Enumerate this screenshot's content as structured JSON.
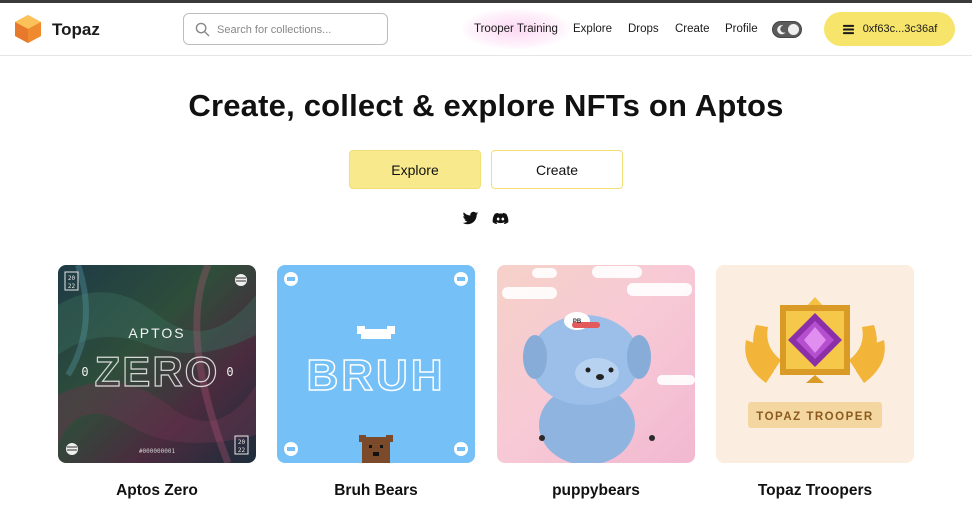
{
  "brand": {
    "name": "Topaz"
  },
  "search": {
    "placeholder": "Search for collections..."
  },
  "nav": {
    "links": [
      "Trooper Training",
      "Explore",
      "Drops",
      "Create",
      "Profile"
    ]
  },
  "wallet": {
    "address": "0xf63c...3c36af"
  },
  "hero": {
    "title": "Create, collect & explore NFTs on Aptos",
    "explore_label": "Explore",
    "create_label": "Create"
  },
  "collections": [
    {
      "name": "Aptos Zero",
      "art_text": [
        "APTOS",
        "ZERO",
        "0",
        "0",
        "20",
        "22",
        "#000000001"
      ]
    },
    {
      "name": "Bruh Bears",
      "art_text": [
        "BRUH"
      ]
    },
    {
      "name": "puppybears",
      "art_text": [
        "PB"
      ]
    },
    {
      "name": "Topaz Troopers",
      "art_text": [
        "TOPAZ TROOPER"
      ]
    }
  ],
  "colors": {
    "accent": "#f7e46a",
    "toggle": "#5b5b5b",
    "bruh_bg": "#74c0f7"
  },
  "icons": [
    "topaz-logo-icon",
    "search-icon",
    "dark-mode-toggle-icon",
    "wallet-icon",
    "twitter-icon",
    "discord-icon"
  ]
}
